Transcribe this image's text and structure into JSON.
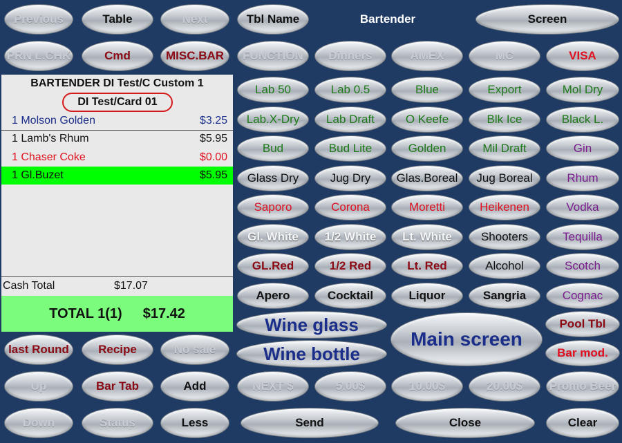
{
  "top": {
    "previous": "Previous",
    "table": "Table",
    "next": "Next",
    "tbl_name": "Tbl Name",
    "mode_label": "Bartender",
    "screen": "Screen"
  },
  "row2": {
    "prn": "PRN L.CHK",
    "cmd": "Cmd",
    "misc_bar": "MISC.BAR",
    "function": "FUNCTION",
    "dinners": "Dinners",
    "amex": "AMEX",
    "mc": "MC",
    "visa": "VISA"
  },
  "check": {
    "header": "BARTENDER DI Test/C Custom  1",
    "card": "DI Test/Card 01",
    "items": [
      {
        "name": "1 Molson Golden",
        "price": "$3.25"
      },
      {
        "name": "1 Lamb's Rhum",
        "price": "$5.95"
      },
      {
        "name": "1 Chaser Coke",
        "price": "$0.00"
      },
      {
        "name": "1 Gl.Buzet",
        "price": "$5.95"
      }
    ],
    "cash_total_label": "Cash Total",
    "cash_total_value": "$17.07",
    "total_label": "TOTAL  1(1)",
    "total_value": "$17.42"
  },
  "grid": [
    [
      "Lab 50",
      "Lab 0.5",
      "Blue",
      "Export",
      "Mol Dry"
    ],
    [
      "Lab.X-Dry",
      "Lab Draft",
      "O Keefe",
      "Blk Ice",
      "Black L."
    ],
    [
      "Bud",
      "Bud Lite",
      "Golden",
      "Mil Draft",
      "Gin"
    ],
    [
      "Glass Dry",
      "Jug Dry",
      "Glas.Boreal",
      "Jug Boreal",
      "Rhum"
    ],
    [
      "Saporo",
      "Corona",
      "Moretti",
      "Heikenen",
      "Vodka"
    ],
    [
      "Gl. White",
      "1/2  White",
      "Lt. White",
      "Shooters",
      "Tequilla"
    ],
    [
      "GL.Red",
      "1/2 Red",
      "Lt. Red",
      "Alcohol",
      "Scotch"
    ],
    [
      "Apero",
      "Cocktail",
      "Liquor",
      "Sangria",
      "Cognac"
    ]
  ],
  "mid": {
    "wine_glass": "Wine glass",
    "wine_bottle": "Wine bottle",
    "main_screen": "Main screen",
    "pool_tbl": "Pool Tbl",
    "bar_mod": "Bar mod."
  },
  "left_bottom": {
    "last_round": "last Round",
    "recipe": "Recipe",
    "no_sale": "No sale",
    "up": "Up",
    "bar_tab": "Bar Tab",
    "add": "Add",
    "down": "Down",
    "status": "Status",
    "less": "Less"
  },
  "cash_row": {
    "next": "NEXT $",
    "five": "5.00$",
    "ten": "10.00$",
    "twenty": "20.00$",
    "promo": "Promo Beer"
  },
  "bottom": {
    "send": "Send",
    "close": "Close",
    "clear": "Clear"
  }
}
